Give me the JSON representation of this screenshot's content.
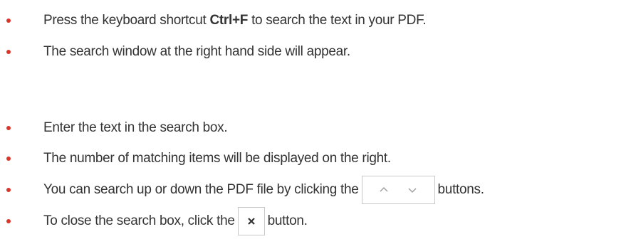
{
  "bullets": [
    {
      "before": "Press the keyboard shortcut ",
      "bold": "Ctrl+F",
      "after": " to search the text in your PDF."
    },
    {
      "text": "The search window at the right hand side will appear."
    },
    {
      "text": "Enter the text in the search box."
    },
    {
      "text": "The number of matching items will be displayed on the right."
    },
    {
      "before": "You can search up or down the PDF file by clicking the",
      "after": "buttons."
    },
    {
      "before": "To close the search box, click the",
      "after": "button."
    }
  ],
  "icons": {
    "bullet": "red-dot",
    "up": "chevron-up-icon",
    "down": "chevron-down-icon",
    "close": "close-icon"
  },
  "colors": {
    "bullet": "#d9362b",
    "text": "#333333",
    "button_border": "#c8c8c8",
    "icon_gray": "#9a9a9a",
    "close_icon": "#333333"
  }
}
